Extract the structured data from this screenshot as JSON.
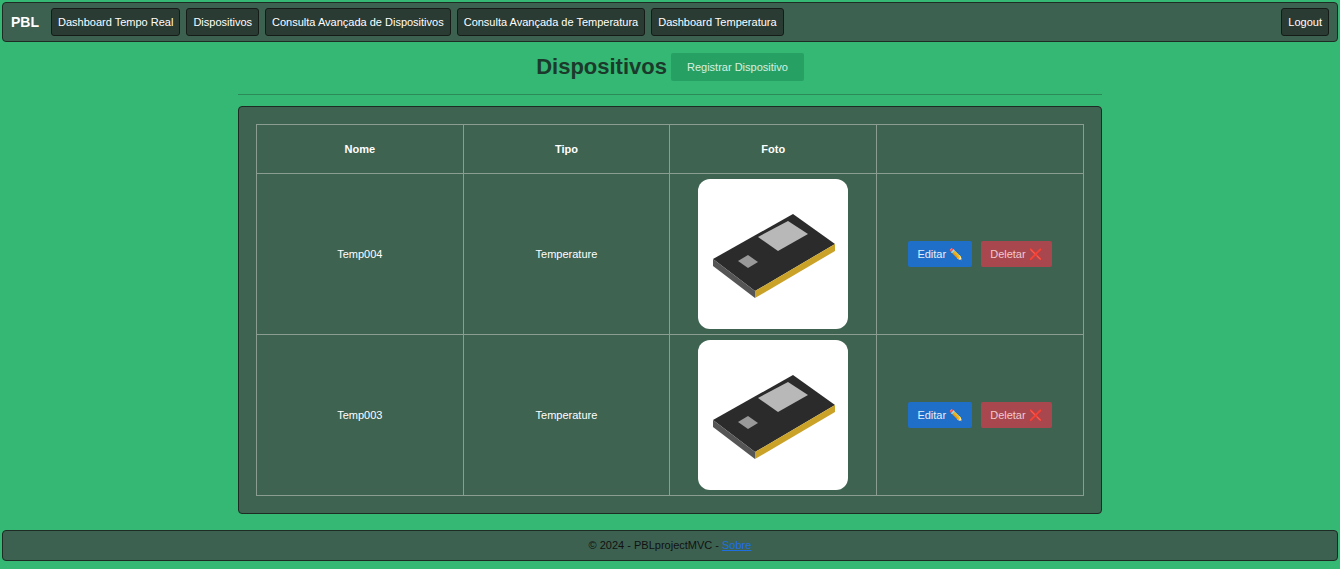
{
  "navbar": {
    "brand": "PBL",
    "links": [
      "Dashboard Tempo Real",
      "Dispositivos",
      "Consulta Avançada de Dispositivos",
      "Consulta Avançada de Temperatura",
      "Dashboard Temperatura"
    ],
    "logout": "Logout"
  },
  "page": {
    "title": "Dispositivos",
    "register_button": "Registrar Dispositivo"
  },
  "table": {
    "columns": [
      "Nome",
      "Tipo",
      "Foto",
      ""
    ],
    "rows": [
      {
        "name": "Temp004",
        "type": "Temperature",
        "edit": "Editar ✏️",
        "delete": "Deletar ❌"
      },
      {
        "name": "Temp003",
        "type": "Temperature",
        "edit": "Editar ✏️",
        "delete": "Deletar ❌"
      }
    ]
  },
  "footer": {
    "text": "© 2024 - PBLprojectMVC - ",
    "link": "Sobre"
  }
}
